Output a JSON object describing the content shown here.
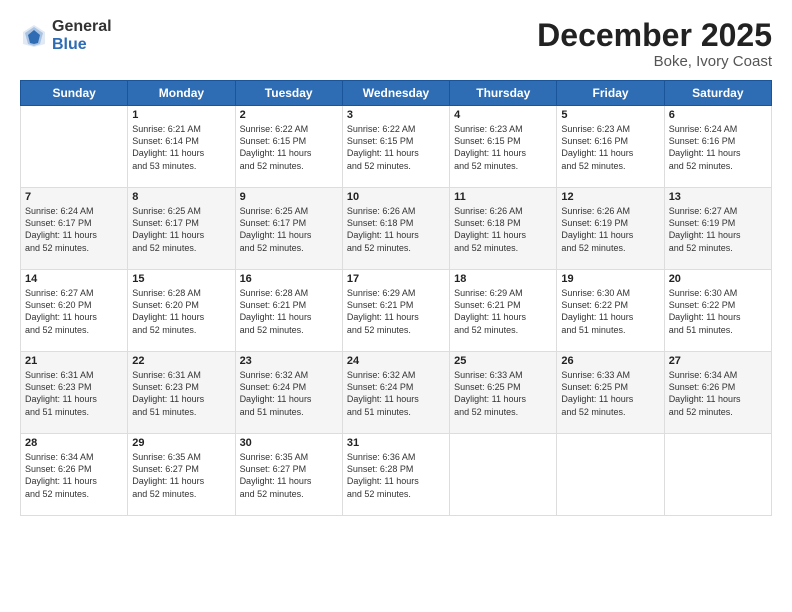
{
  "logo": {
    "general": "General",
    "blue": "Blue"
  },
  "header": {
    "title": "December 2025",
    "subtitle": "Boke, Ivory Coast"
  },
  "weekdays": [
    "Sunday",
    "Monday",
    "Tuesday",
    "Wednesday",
    "Thursday",
    "Friday",
    "Saturday"
  ],
  "weeks": [
    [
      {
        "day": "",
        "info": ""
      },
      {
        "day": "1",
        "info": "Sunrise: 6:21 AM\nSunset: 6:14 PM\nDaylight: 11 hours\nand 53 minutes."
      },
      {
        "day": "2",
        "info": "Sunrise: 6:22 AM\nSunset: 6:15 PM\nDaylight: 11 hours\nand 52 minutes."
      },
      {
        "day": "3",
        "info": "Sunrise: 6:22 AM\nSunset: 6:15 PM\nDaylight: 11 hours\nand 52 minutes."
      },
      {
        "day": "4",
        "info": "Sunrise: 6:23 AM\nSunset: 6:15 PM\nDaylight: 11 hours\nand 52 minutes."
      },
      {
        "day": "5",
        "info": "Sunrise: 6:23 AM\nSunset: 6:16 PM\nDaylight: 11 hours\nand 52 minutes."
      },
      {
        "day": "6",
        "info": "Sunrise: 6:24 AM\nSunset: 6:16 PM\nDaylight: 11 hours\nand 52 minutes."
      }
    ],
    [
      {
        "day": "7",
        "info": "Sunrise: 6:24 AM\nSunset: 6:17 PM\nDaylight: 11 hours\nand 52 minutes."
      },
      {
        "day": "8",
        "info": "Sunrise: 6:25 AM\nSunset: 6:17 PM\nDaylight: 11 hours\nand 52 minutes."
      },
      {
        "day": "9",
        "info": "Sunrise: 6:25 AM\nSunset: 6:17 PM\nDaylight: 11 hours\nand 52 minutes."
      },
      {
        "day": "10",
        "info": "Sunrise: 6:26 AM\nSunset: 6:18 PM\nDaylight: 11 hours\nand 52 minutes."
      },
      {
        "day": "11",
        "info": "Sunrise: 6:26 AM\nSunset: 6:18 PM\nDaylight: 11 hours\nand 52 minutes."
      },
      {
        "day": "12",
        "info": "Sunrise: 6:26 AM\nSunset: 6:19 PM\nDaylight: 11 hours\nand 52 minutes."
      },
      {
        "day": "13",
        "info": "Sunrise: 6:27 AM\nSunset: 6:19 PM\nDaylight: 11 hours\nand 52 minutes."
      }
    ],
    [
      {
        "day": "14",
        "info": "Sunrise: 6:27 AM\nSunset: 6:20 PM\nDaylight: 11 hours\nand 52 minutes."
      },
      {
        "day": "15",
        "info": "Sunrise: 6:28 AM\nSunset: 6:20 PM\nDaylight: 11 hours\nand 52 minutes."
      },
      {
        "day": "16",
        "info": "Sunrise: 6:28 AM\nSunset: 6:21 PM\nDaylight: 11 hours\nand 52 minutes."
      },
      {
        "day": "17",
        "info": "Sunrise: 6:29 AM\nSunset: 6:21 PM\nDaylight: 11 hours\nand 52 minutes."
      },
      {
        "day": "18",
        "info": "Sunrise: 6:29 AM\nSunset: 6:21 PM\nDaylight: 11 hours\nand 52 minutes."
      },
      {
        "day": "19",
        "info": "Sunrise: 6:30 AM\nSunset: 6:22 PM\nDaylight: 11 hours\nand 51 minutes."
      },
      {
        "day": "20",
        "info": "Sunrise: 6:30 AM\nSunset: 6:22 PM\nDaylight: 11 hours\nand 51 minutes."
      }
    ],
    [
      {
        "day": "21",
        "info": "Sunrise: 6:31 AM\nSunset: 6:23 PM\nDaylight: 11 hours\nand 51 minutes."
      },
      {
        "day": "22",
        "info": "Sunrise: 6:31 AM\nSunset: 6:23 PM\nDaylight: 11 hours\nand 51 minutes."
      },
      {
        "day": "23",
        "info": "Sunrise: 6:32 AM\nSunset: 6:24 PM\nDaylight: 11 hours\nand 51 minutes."
      },
      {
        "day": "24",
        "info": "Sunrise: 6:32 AM\nSunset: 6:24 PM\nDaylight: 11 hours\nand 51 minutes."
      },
      {
        "day": "25",
        "info": "Sunrise: 6:33 AM\nSunset: 6:25 PM\nDaylight: 11 hours\nand 52 minutes."
      },
      {
        "day": "26",
        "info": "Sunrise: 6:33 AM\nSunset: 6:25 PM\nDaylight: 11 hours\nand 52 minutes."
      },
      {
        "day": "27",
        "info": "Sunrise: 6:34 AM\nSunset: 6:26 PM\nDaylight: 11 hours\nand 52 minutes."
      }
    ],
    [
      {
        "day": "28",
        "info": "Sunrise: 6:34 AM\nSunset: 6:26 PM\nDaylight: 11 hours\nand 52 minutes."
      },
      {
        "day": "29",
        "info": "Sunrise: 6:35 AM\nSunset: 6:27 PM\nDaylight: 11 hours\nand 52 minutes."
      },
      {
        "day": "30",
        "info": "Sunrise: 6:35 AM\nSunset: 6:27 PM\nDaylight: 11 hours\nand 52 minutes."
      },
      {
        "day": "31",
        "info": "Sunrise: 6:36 AM\nSunset: 6:28 PM\nDaylight: 11 hours\nand 52 minutes."
      },
      {
        "day": "",
        "info": ""
      },
      {
        "day": "",
        "info": ""
      },
      {
        "day": "",
        "info": ""
      }
    ]
  ]
}
